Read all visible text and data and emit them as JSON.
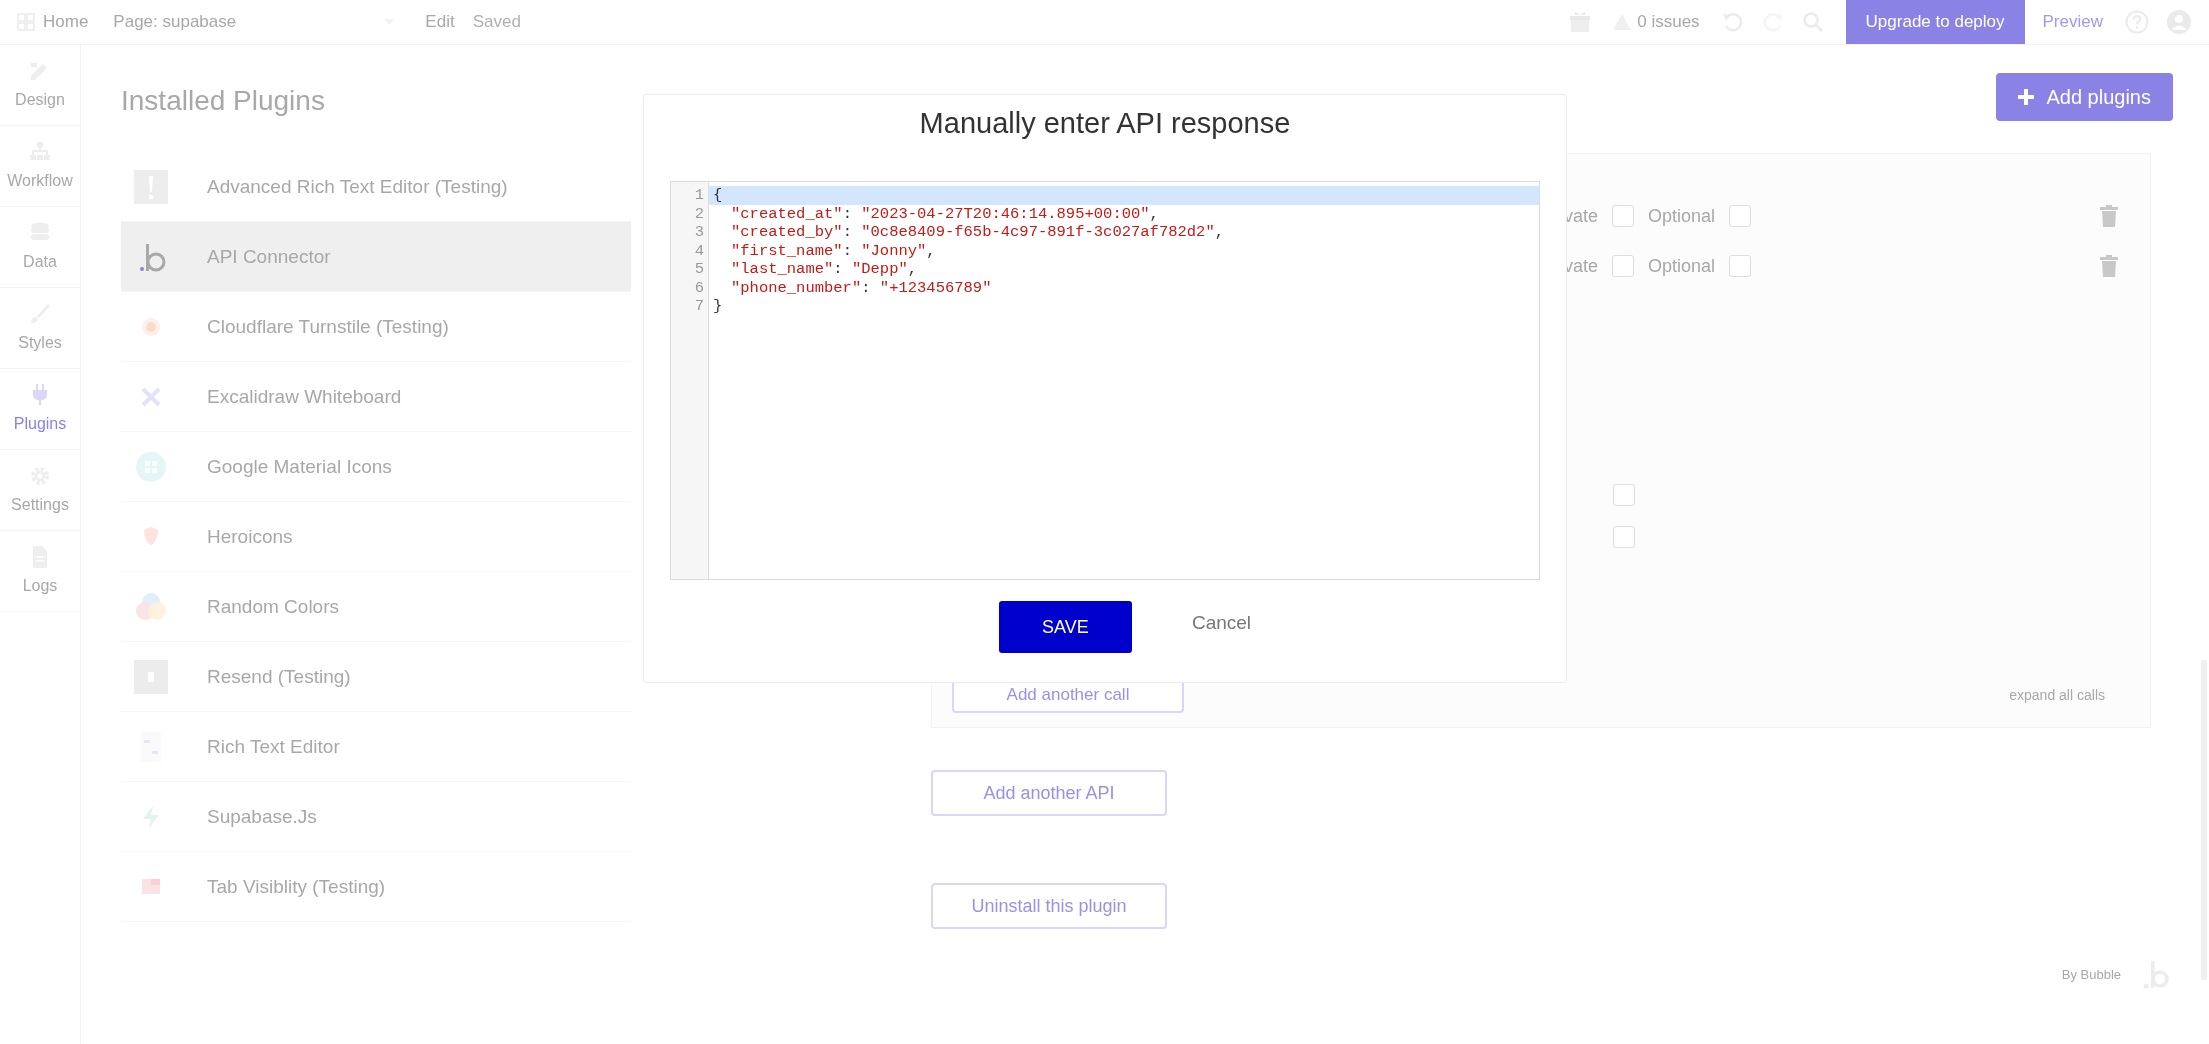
{
  "top_bar": {
    "home": "Home",
    "page": "Page: supabase",
    "edit": "Edit",
    "saved": "Saved",
    "issues": "0 issues",
    "upgrade": "Upgrade to deploy",
    "preview": "Preview"
  },
  "sidebar": {
    "items": [
      {
        "label": "Design",
        "selected": false
      },
      {
        "label": "Workflow",
        "selected": false
      },
      {
        "label": "Data",
        "selected": false
      },
      {
        "label": "Styles",
        "selected": false
      },
      {
        "label": "Plugins",
        "selected": true
      },
      {
        "label": "Settings",
        "selected": false
      },
      {
        "label": "Logs",
        "selected": false
      }
    ]
  },
  "main": {
    "title": "Installed Plugins",
    "add_plugins": "Add plugins",
    "plugins": [
      {
        "name": "Advanced Rich Text Editor (Testing)",
        "selected": false
      },
      {
        "name": "API Connector",
        "selected": true
      },
      {
        "name": "Cloudflare Turnstile (Testing)",
        "selected": false
      },
      {
        "name": "Excalidraw Whiteboard",
        "selected": false
      },
      {
        "name": "Google Material Icons",
        "selected": false
      },
      {
        "name": "Heroicons",
        "selected": false
      },
      {
        "name": "Random Colors",
        "selected": false
      },
      {
        "name": "Resend (Testing)",
        "selected": false
      },
      {
        "name": "Rich Text Editor",
        "selected": false
      },
      {
        "name": "Supabase.Js",
        "selected": false
      },
      {
        "name": "Tab Visiblity (Testing)",
        "selected": false
      }
    ],
    "api_panel": {
      "param_rows": [
        {
          "label": "vate",
          "private_checked": false,
          "optional": "Optional",
          "optional_checked": false
        },
        {
          "label": "vate",
          "private_checked": false,
          "optional": "Optional",
          "optional_checked": false
        }
      ],
      "extra_checkboxes": [
        {
          "checked": false
        },
        {
          "checked": false
        }
      ],
      "add_call": "Add another call",
      "expand_all": "expand all calls"
    },
    "add_api": "Add another API",
    "uninstall": "Uninstall this plugin",
    "footer": "By Bubble"
  },
  "modal": {
    "title": "Manually enter API response",
    "lines": [
      {
        "number": "1",
        "active": true,
        "tokens": [
          {
            "kind": "punct",
            "text": "{"
          }
        ]
      },
      {
        "number": "2",
        "active": false,
        "tokens": [
          {
            "kind": "string",
            "text": "\"created_at\""
          },
          {
            "kind": "punct",
            "text": ": "
          },
          {
            "kind": "string",
            "text": "\"2023-04-27T20:46:14.895+00:00\""
          },
          {
            "kind": "punct",
            "text": ","
          }
        ]
      },
      {
        "number": "3",
        "active": false,
        "tokens": [
          {
            "kind": "string",
            "text": "\"created_by\""
          },
          {
            "kind": "punct",
            "text": ": "
          },
          {
            "kind": "string",
            "text": "\"0c8e8409-f65b-4c97-891f-3c027af782d2\""
          },
          {
            "kind": "punct",
            "text": ","
          }
        ]
      },
      {
        "number": "4",
        "active": false,
        "tokens": [
          {
            "kind": "string",
            "text": "\"first_name\""
          },
          {
            "kind": "punct",
            "text": ": "
          },
          {
            "kind": "string",
            "text": "\"Jonny\""
          },
          {
            "kind": "punct",
            "text": ","
          }
        ]
      },
      {
        "number": "5",
        "active": false,
        "tokens": [
          {
            "kind": "string",
            "text": "\"last_name\""
          },
          {
            "kind": "punct",
            "text": ": "
          },
          {
            "kind": "string",
            "text": "\"Depp\""
          },
          {
            "kind": "punct",
            "text": ","
          }
        ]
      },
      {
        "number": "6",
        "active": false,
        "tokens": [
          {
            "kind": "string",
            "text": "\"phone_number\""
          },
          {
            "kind": "punct",
            "text": ": "
          },
          {
            "kind": "string",
            "text": "\"+123456789\""
          }
        ]
      },
      {
        "number": "7",
        "active": false,
        "tokens": [
          {
            "kind": "punct",
            "text": "}"
          }
        ]
      }
    ],
    "save": "SAVE",
    "cancel": "Cancel"
  }
}
